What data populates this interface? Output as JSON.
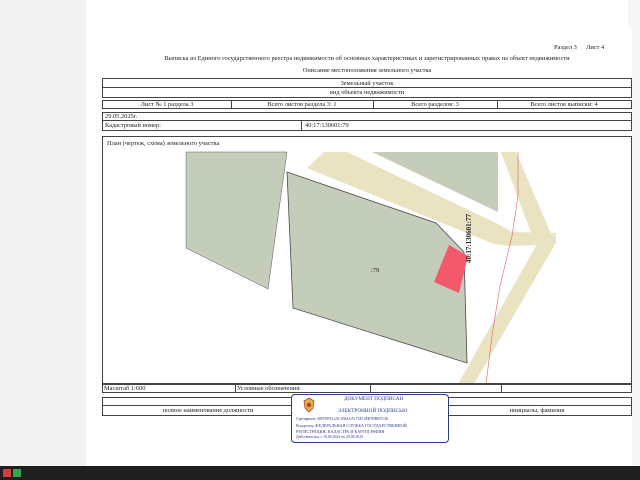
{
  "header": {
    "section_label": "Раздел 3",
    "sheet_label": "Лист 4",
    "title": "Выписка из Единого государственного реестра недвижимости об основных характеристиках и зарегистрированных правах на объект недвижимости",
    "subtitle": "Описание местоположения земельного участка"
  },
  "object": {
    "type": "Земельный участок",
    "type_caption": "вид объекта недвижимости"
  },
  "sheet_info": {
    "sheet_no": "Лист № 1 раздела 3",
    "total_sheets_section": "Всего листов раздела 3: 1",
    "total_sections": "Всего разделов: 3",
    "total_sheets_extract": "Всего листов выписки: 4"
  },
  "date": "29.05.2025г.",
  "cadastral": {
    "label": "Кадастровый номер:",
    "value": "40:17:130601:79"
  },
  "plan": {
    "title": "План (чертеж, схема) земельного участка",
    "parcel_label": ":79",
    "neighbor_label": "40:17:130601:77"
  },
  "legend": {
    "scale": "Масштаб 1:600",
    "symbols": "Условные обозначения:"
  },
  "signature": {
    "position_caption": "полное наименование должности",
    "name_caption": "инициалы, фамилия"
  },
  "stamp": {
    "title": "ДОКУМЕНТ ПОДПИСАН",
    "subtitle": "ЭЛЕКТРОННОЙ ПОДПИСЬЮ",
    "cert": "Сертификат: 00FF0FE12AC0384AA172E14FB7BBB7C4E",
    "owner1": "Владелец: ФЕДЕРАЛЬНАЯ СЛУЖБА ГОСУДАРСТВЕННОЙ",
    "owner2": "РЕГИСТРАЦИИ, КАДАСТРА И КАРТОГРАФИИ",
    "valid": "Действителен: с 10.06.2024 по 29.08.2025"
  },
  "colors": {
    "parcel_fill": "#c4ccba",
    "road_fill": "#e9e3c2",
    "highlight_fill": "#f2596a",
    "stamp_blue": "#2f3a8a"
  },
  "icons": [
    "emblem-icon",
    "taskbar-app-icons"
  ]
}
